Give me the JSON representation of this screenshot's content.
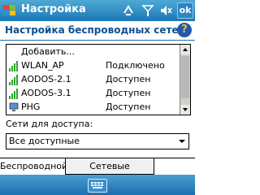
{
  "titlebar": {
    "title": "Настройка",
    "ok_label": "ok"
  },
  "header": {
    "title": "Настройка беспроводных сетей",
    "help_label": "?"
  },
  "networks": {
    "add_label": "Добавить...",
    "items": [
      {
        "name": "WLAN_AP",
        "status": "Подключено"
      },
      {
        "name": "AODOS-2.1",
        "status": "Доступен"
      },
      {
        "name": "AODOS-3.1",
        "status": "Доступен"
      },
      {
        "name": "PHG",
        "status": "Доступен"
      }
    ]
  },
  "access": {
    "label": "Сети для доступа:",
    "selected": "Все доступные"
  },
  "tabs": [
    {
      "label": "Беспроводной"
    },
    {
      "label": "Сетевые адаптеры"
    }
  ],
  "colors": {
    "titlebar": "#1b78b6",
    "header_text": "#0f4f8f",
    "signal_green": "#2aa52a"
  }
}
